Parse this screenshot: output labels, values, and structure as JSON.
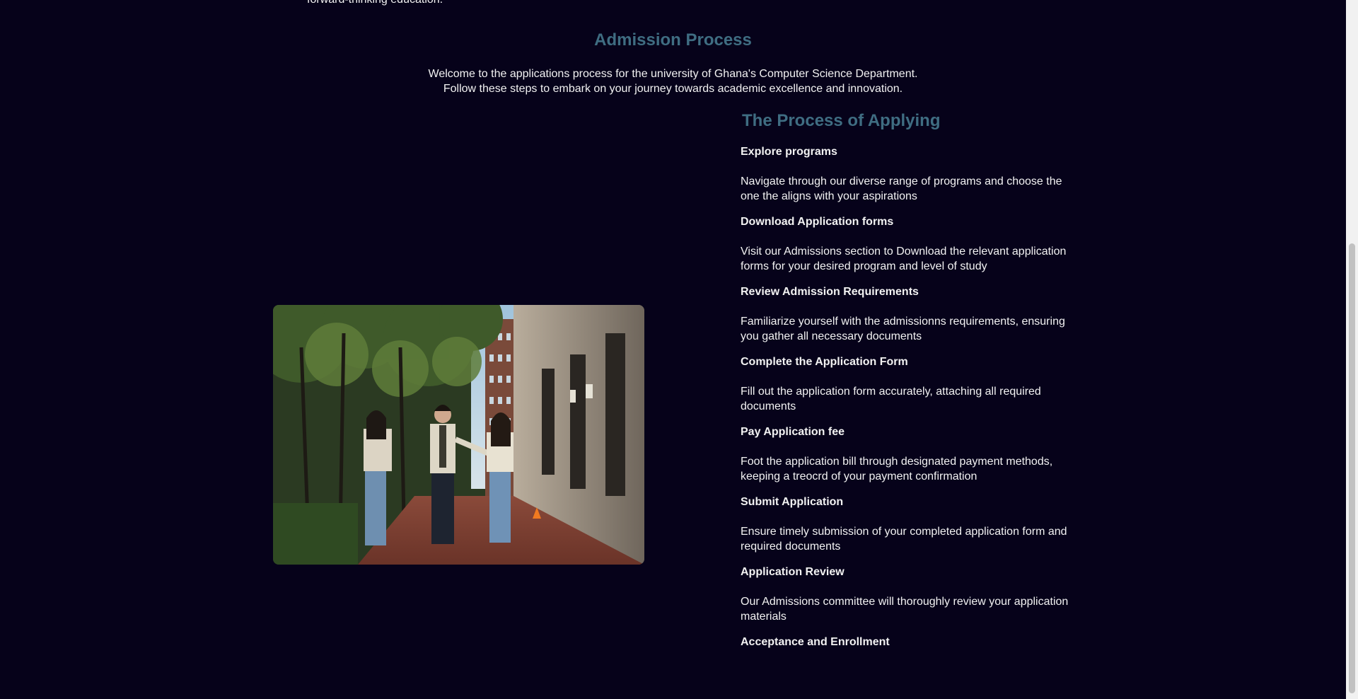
{
  "top_fragment": "forward-thinking education.",
  "admission": {
    "title": "Admission Process",
    "intro_line1": "Welcome to the applications process for the university of Ghana's Computer Science Department.",
    "intro_line2": "Follow these steps to embark on your journey towards academic excellence and innovation."
  },
  "image": {
    "subject": "students-walking-photo"
  },
  "process": {
    "title": "The Process of Applying",
    "steps": [
      {
        "title": "Explore programs",
        "description": "Navigate through our diverse range of programs and choose the one the aligns with your aspirations"
      },
      {
        "title": "Download Application forms",
        "description": "Visit our Admissions section to Download the relevant application forms for your desired program and level of study"
      },
      {
        "title": "Review Admission Requirements",
        "description": "Familiarize yourself with the admissionns requirements, ensuring you gather all necessary documents"
      },
      {
        "title": "Complete the Application Form",
        "description": "Fill out the application form accurately, attaching all required documents"
      },
      {
        "title": "Pay Application fee",
        "description": "Foot the application bill through designated payment methods, keeping a treocrd of your payment confirmation"
      },
      {
        "title": "Submit Application",
        "description": "Ensure timely submission of your completed application form and required documents"
      },
      {
        "title": "Application Review",
        "description": "Our Admissions committee will thoroughly review your application materials"
      },
      {
        "title": "Acceptance and Enrollment",
        "description": ""
      }
    ]
  },
  "colors": {
    "background": "#06021a",
    "heading": "#3f6d82",
    "text": "#f2f2f2"
  }
}
